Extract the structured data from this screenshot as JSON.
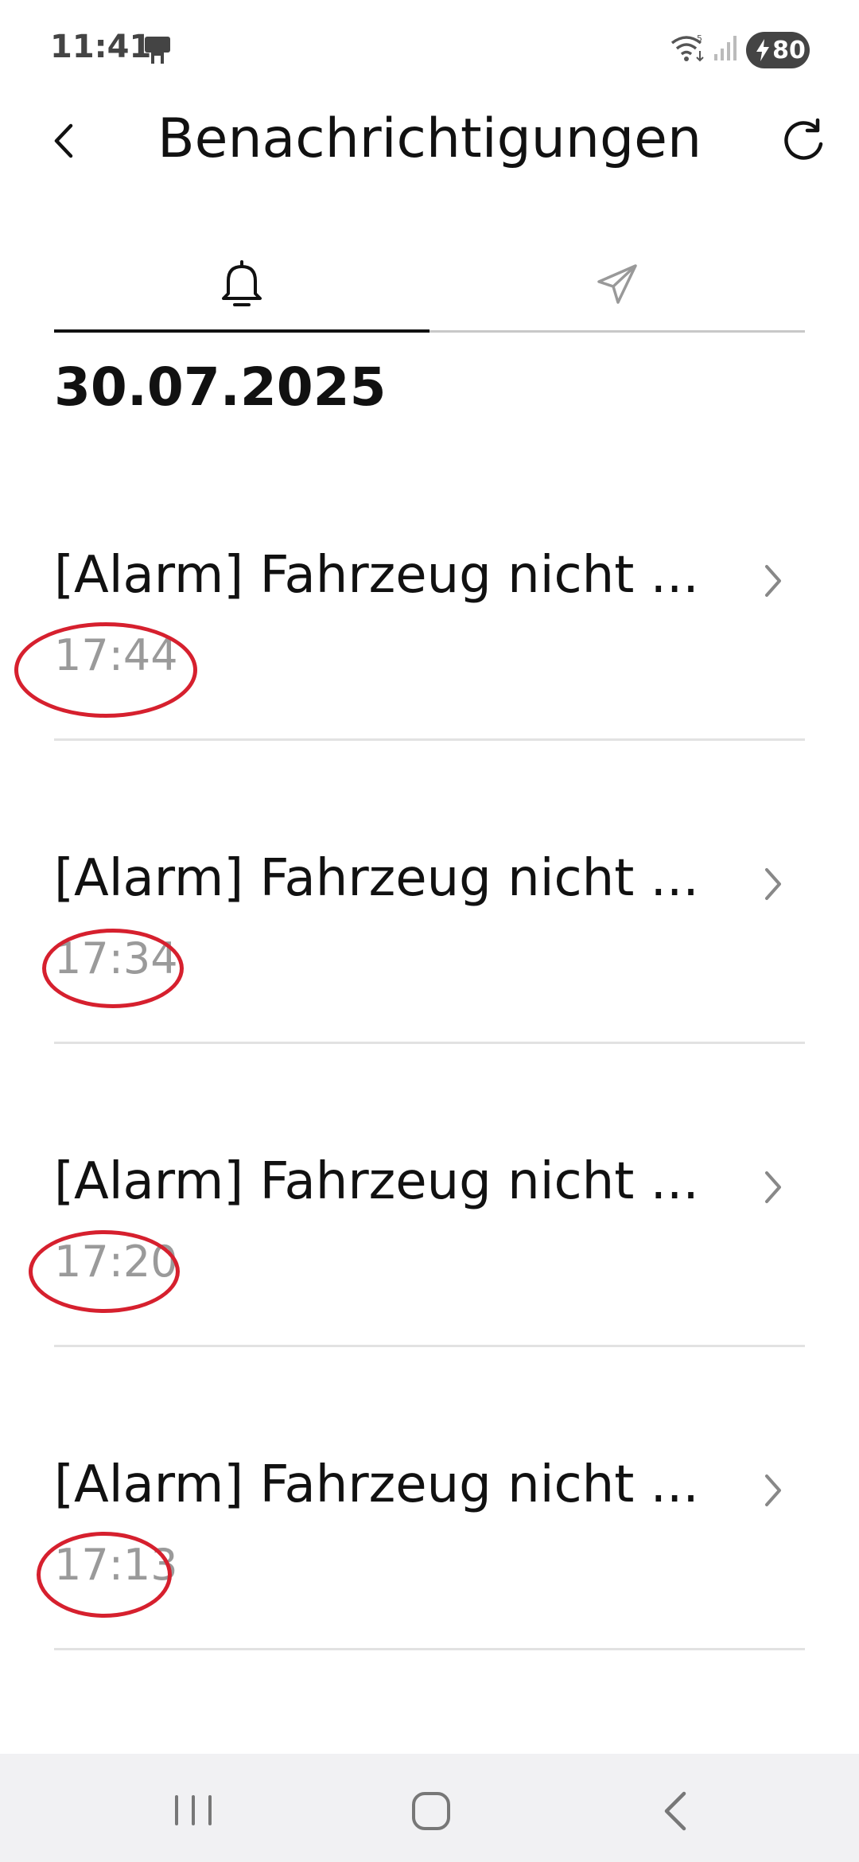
{
  "status_bar": {
    "time": "11:41",
    "battery": "80",
    "app_icon": "phone-app-icon",
    "wifi_icon": "wifi-icon",
    "signal_icon": "signal-icon"
  },
  "header": {
    "title": "Benachrichtigungen",
    "back_icon": "chevron-left-icon",
    "refresh_icon": "refresh-icon"
  },
  "tabs": [
    {
      "icon": "bell-icon",
      "active": true
    },
    {
      "icon": "send-icon",
      "active": false
    }
  ],
  "date": "30.07.2025",
  "notifications": [
    {
      "title": "[Alarm] Fahrzeug nicht ...",
      "time": "17:44",
      "highlighted": true
    },
    {
      "title": "[Alarm] Fahrzeug nicht ...",
      "time": "17:34",
      "highlighted": true
    },
    {
      "title": "[Alarm] Fahrzeug nicht ...",
      "time": "17:20",
      "highlighted": true
    },
    {
      "title": "[Alarm] Fahrzeug nicht ...",
      "time": "17:13",
      "highlighted": true
    }
  ],
  "colors": {
    "highlight": "#d6202e",
    "time_text": "#9a9a9a",
    "active_tab": "#111111",
    "nav_bar_bg": "#f1f1f3"
  },
  "nav_bar": {
    "recents_icon": "recents-icon",
    "home_icon": "home-icon",
    "back_icon": "back-icon"
  }
}
